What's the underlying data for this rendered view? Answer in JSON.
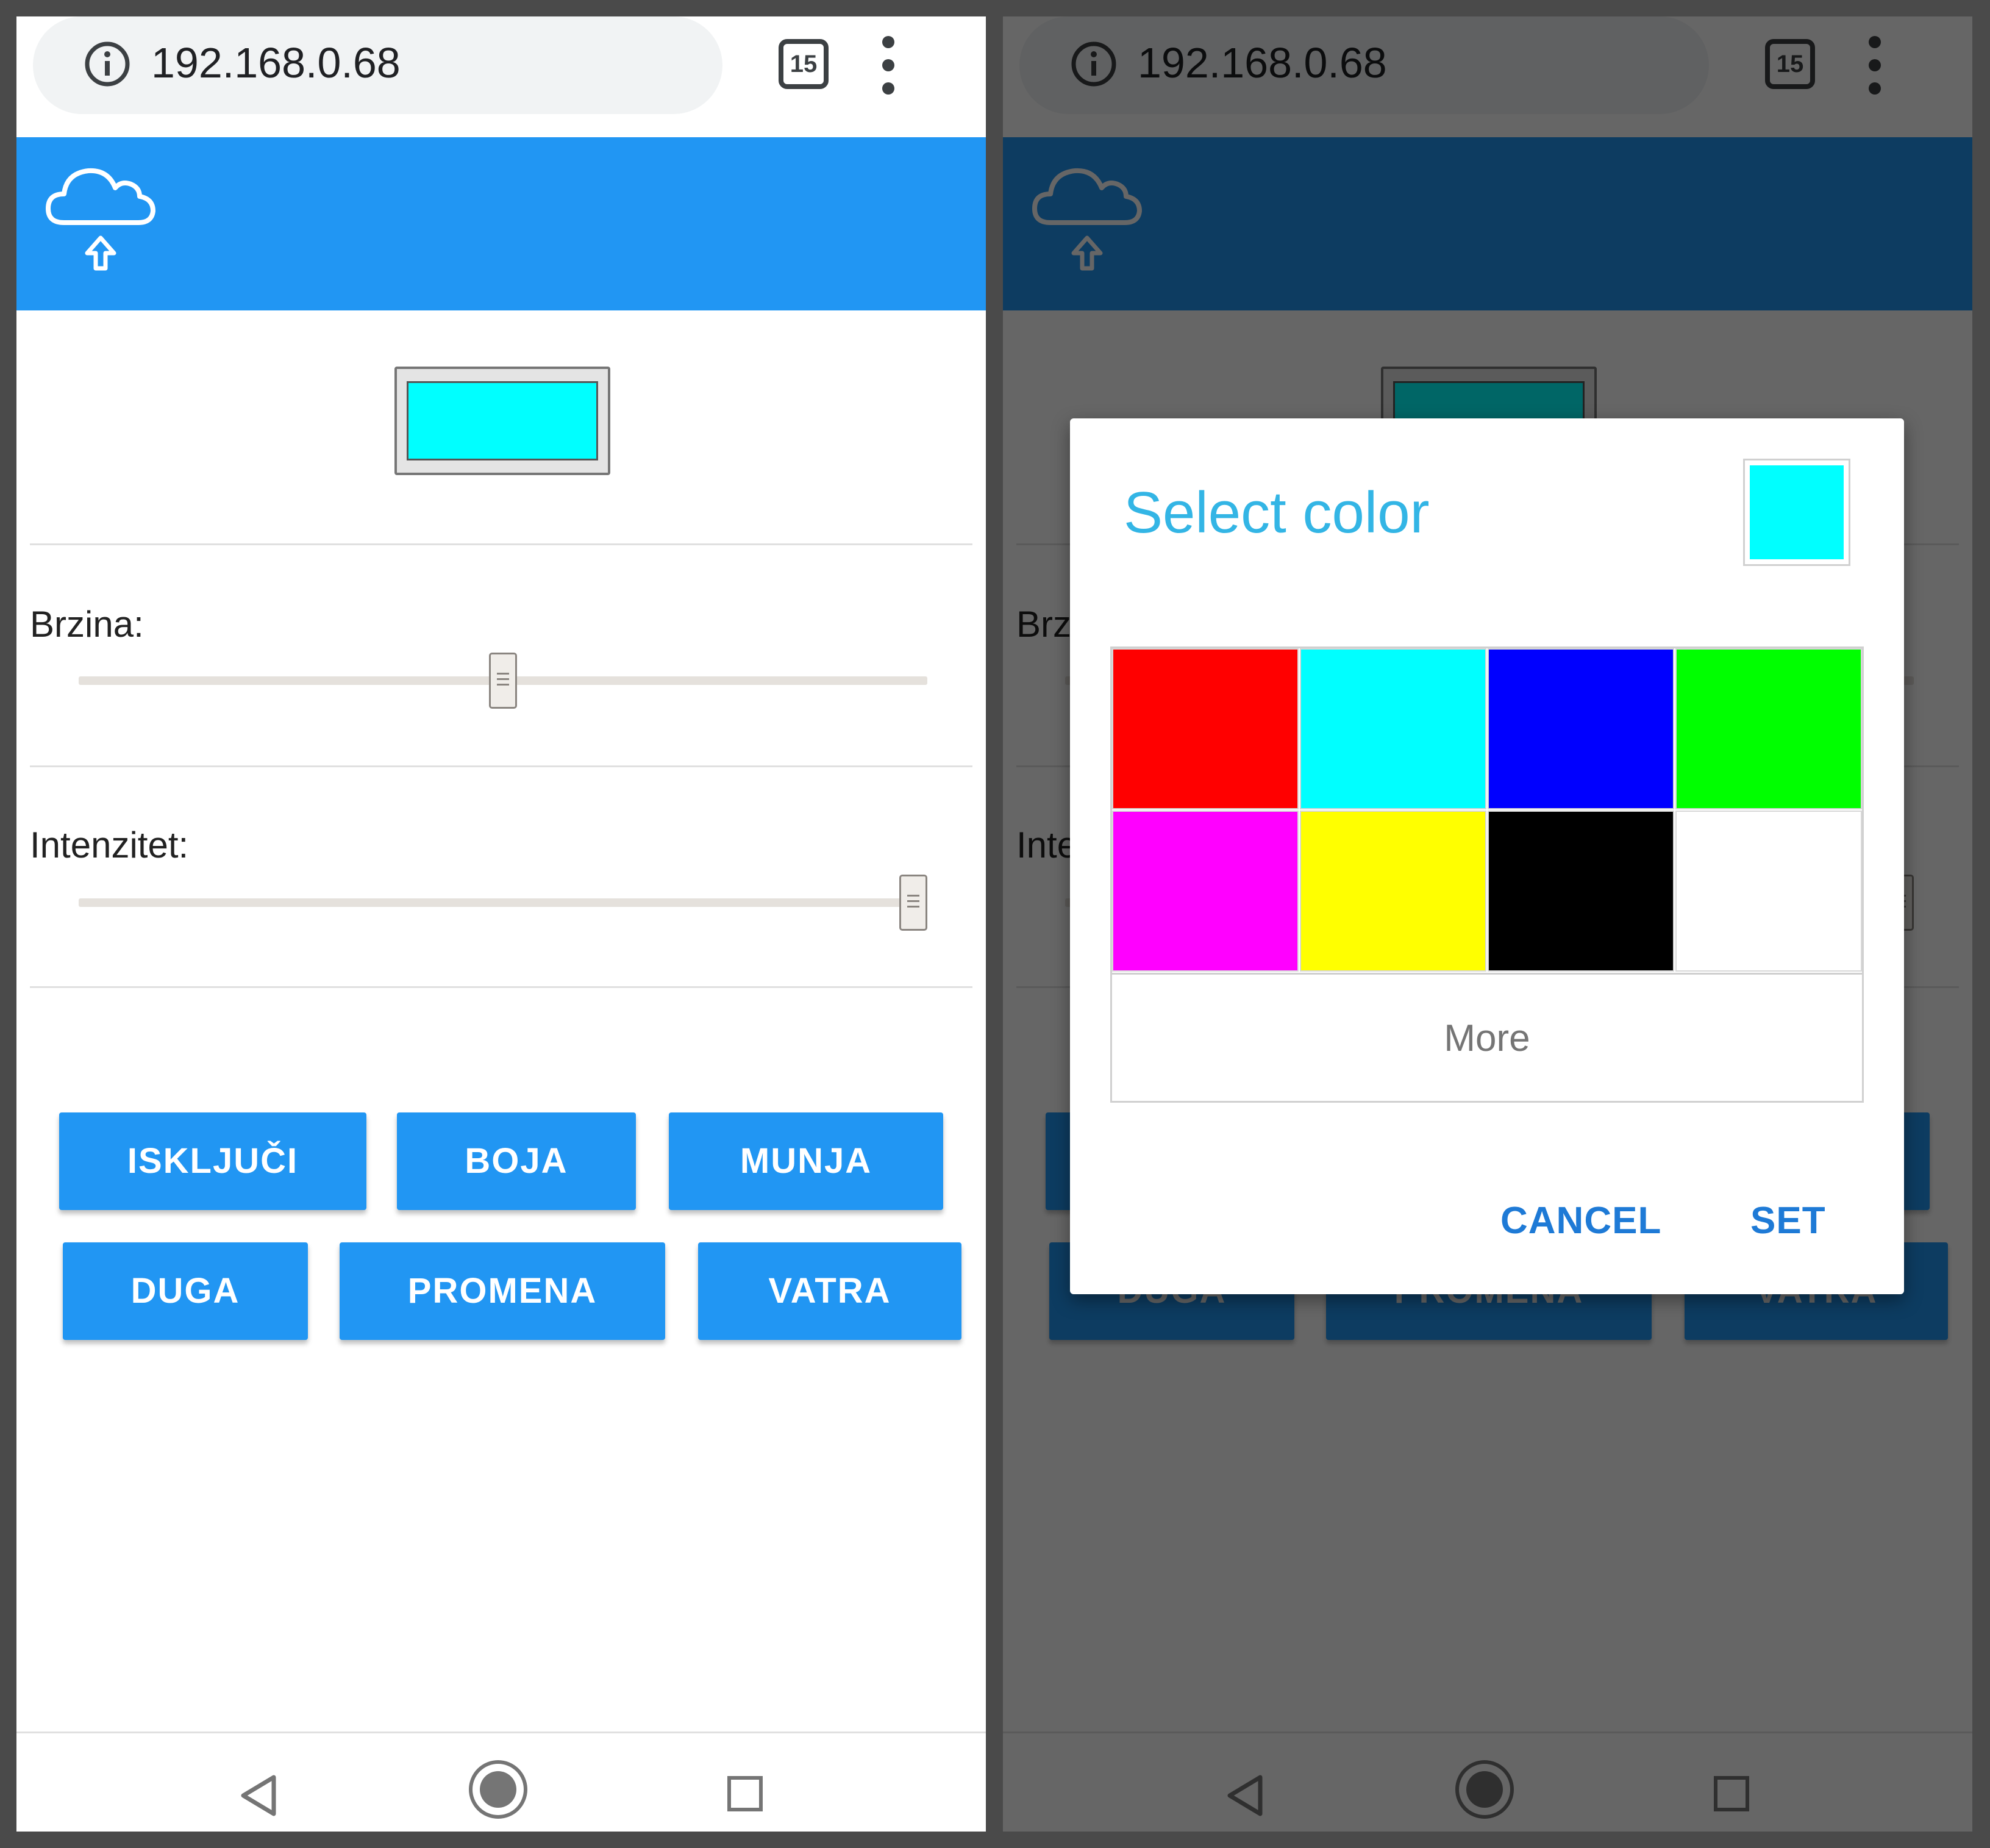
{
  "browser": {
    "url": "192.168.0.68",
    "tab_count": "15"
  },
  "page": {
    "selected_color": "#00ffff",
    "header_color": "#2196f3",
    "sliders": [
      {
        "label": "Brzina:",
        "value_fraction": 0.5
      },
      {
        "label": "Intenzitet:",
        "value_fraction": 1.0
      }
    ],
    "buttons": {
      "iskljuci": "ISKLJUČI",
      "boja": "BOJA",
      "munja": "MUNJA",
      "duga": "DUGA",
      "promena": "PROMENA",
      "vatra": "VATRA"
    }
  },
  "dialog": {
    "title": "Select color",
    "current_color": "#00ffff",
    "palette": [
      "#ff0000",
      "#00ffff",
      "#0000ff",
      "#00ff00",
      "#ff00ff",
      "#ffff00",
      "#000000",
      "#ffffff"
    ],
    "more_label": "More",
    "cancel_label": "CANCEL",
    "set_label": "SET"
  },
  "icons": {
    "info": "info-icon",
    "tabs": "tabs-icon",
    "menu": "more-vert-icon",
    "cloud": "cloud-upload-icon",
    "nav_back": "back-triangle-icon",
    "nav_home": "home-circle-icon",
    "nav_recent": "recent-square-icon"
  }
}
